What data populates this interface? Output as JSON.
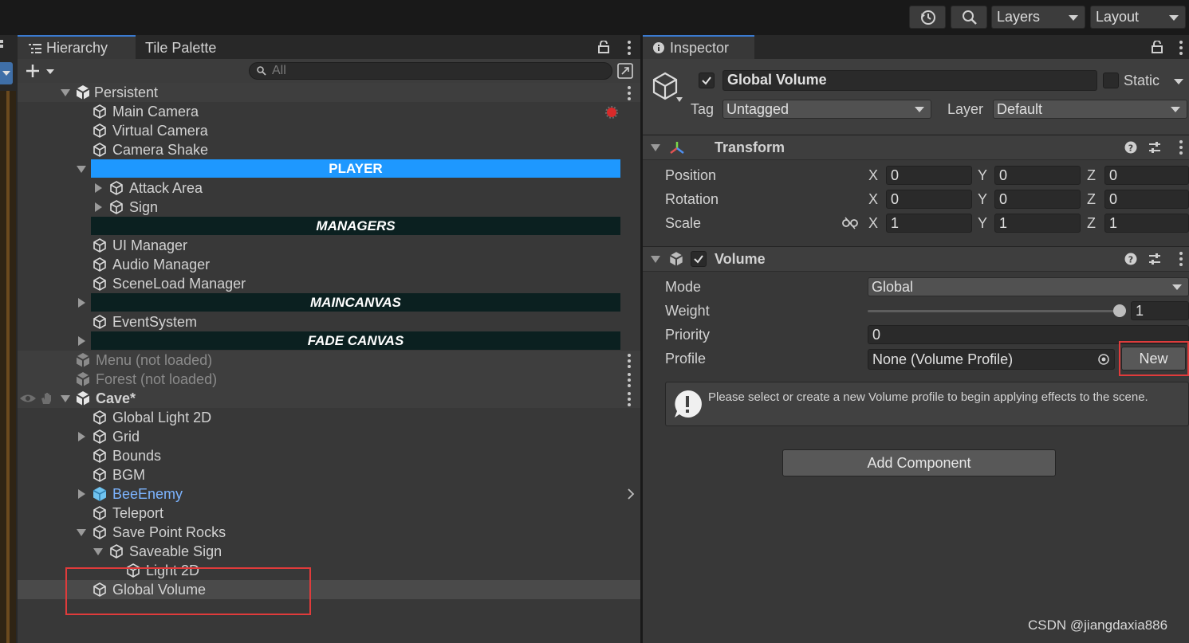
{
  "topbar": {
    "layers_label": "Layers",
    "layout_label": "Layout",
    "icons": [
      "history-icon",
      "search-icon"
    ]
  },
  "hierarchy": {
    "tab_label": "Hierarchy",
    "tile_palette_label": "Tile Palette",
    "search_placeholder": "All",
    "persistent_scene": "Persistent",
    "main_camera": "Main Camera",
    "virtual_camera": "Virtual Camera",
    "camera_shake": "Camera Shake",
    "player_header": "PLAYER",
    "attack_area": "Attack Area",
    "sign": "Sign",
    "managers_header": "MANAGERS",
    "ui_manager": "UI Manager",
    "audio_manager": "Audio Manager",
    "sceneload_manager": "SceneLoad Manager",
    "maincanvas_header": "MAINCANVAS",
    "event_system": "EventSystem",
    "fade_canvas_header": "FADE CANVAS",
    "menu_scene": "Menu (not loaded)",
    "forest_scene": "Forest (not loaded)",
    "cave_scene": "Cave*",
    "global_light": "Global Light 2D",
    "grid": "Grid",
    "bounds": "Bounds",
    "bgm": "BGM",
    "bee_enemy": "BeeEnemy",
    "teleport": "Teleport",
    "save_point_rocks": "Save Point Rocks",
    "saveable_sign": "Saveable Sign",
    "light_2d": "Light 2D",
    "global_volume": "Global Volume"
  },
  "colors": {
    "player_bar": "#1e98ff",
    "dark_header_bar": "#0b2020",
    "prefab_blue": "#7cb4ff",
    "highlight_red": "#e03b3b"
  },
  "inspector": {
    "tab_label": "Inspector",
    "object_name": "Global Volume",
    "static_label": "Static",
    "tag_label": "Tag",
    "tag_value": "Untagged",
    "layer_label": "Layer",
    "layer_value": "Default",
    "transform": {
      "title": "Transform",
      "position_label": "Position",
      "rotation_label": "Rotation",
      "scale_label": "Scale",
      "x": "X",
      "y": "Y",
      "z": "Z",
      "position": [
        "0",
        "0",
        "0"
      ],
      "rotation": [
        "0",
        "0",
        "0"
      ],
      "scale": [
        "1",
        "1",
        "1"
      ]
    },
    "volume": {
      "title": "Volume",
      "mode_label": "Mode",
      "mode_value": "Global",
      "weight_label": "Weight",
      "weight_value": "1",
      "weight_fraction": 1.0,
      "priority_label": "Priority",
      "priority_value": "0",
      "profile_label": "Profile",
      "profile_value": "None (Volume Profile)",
      "new_button": "New",
      "help_message": "Please select or create a new Volume profile to begin applying effects to the scene."
    },
    "add_component": "Add Component"
  },
  "watermark": "CSDN @jiangdaxia886"
}
